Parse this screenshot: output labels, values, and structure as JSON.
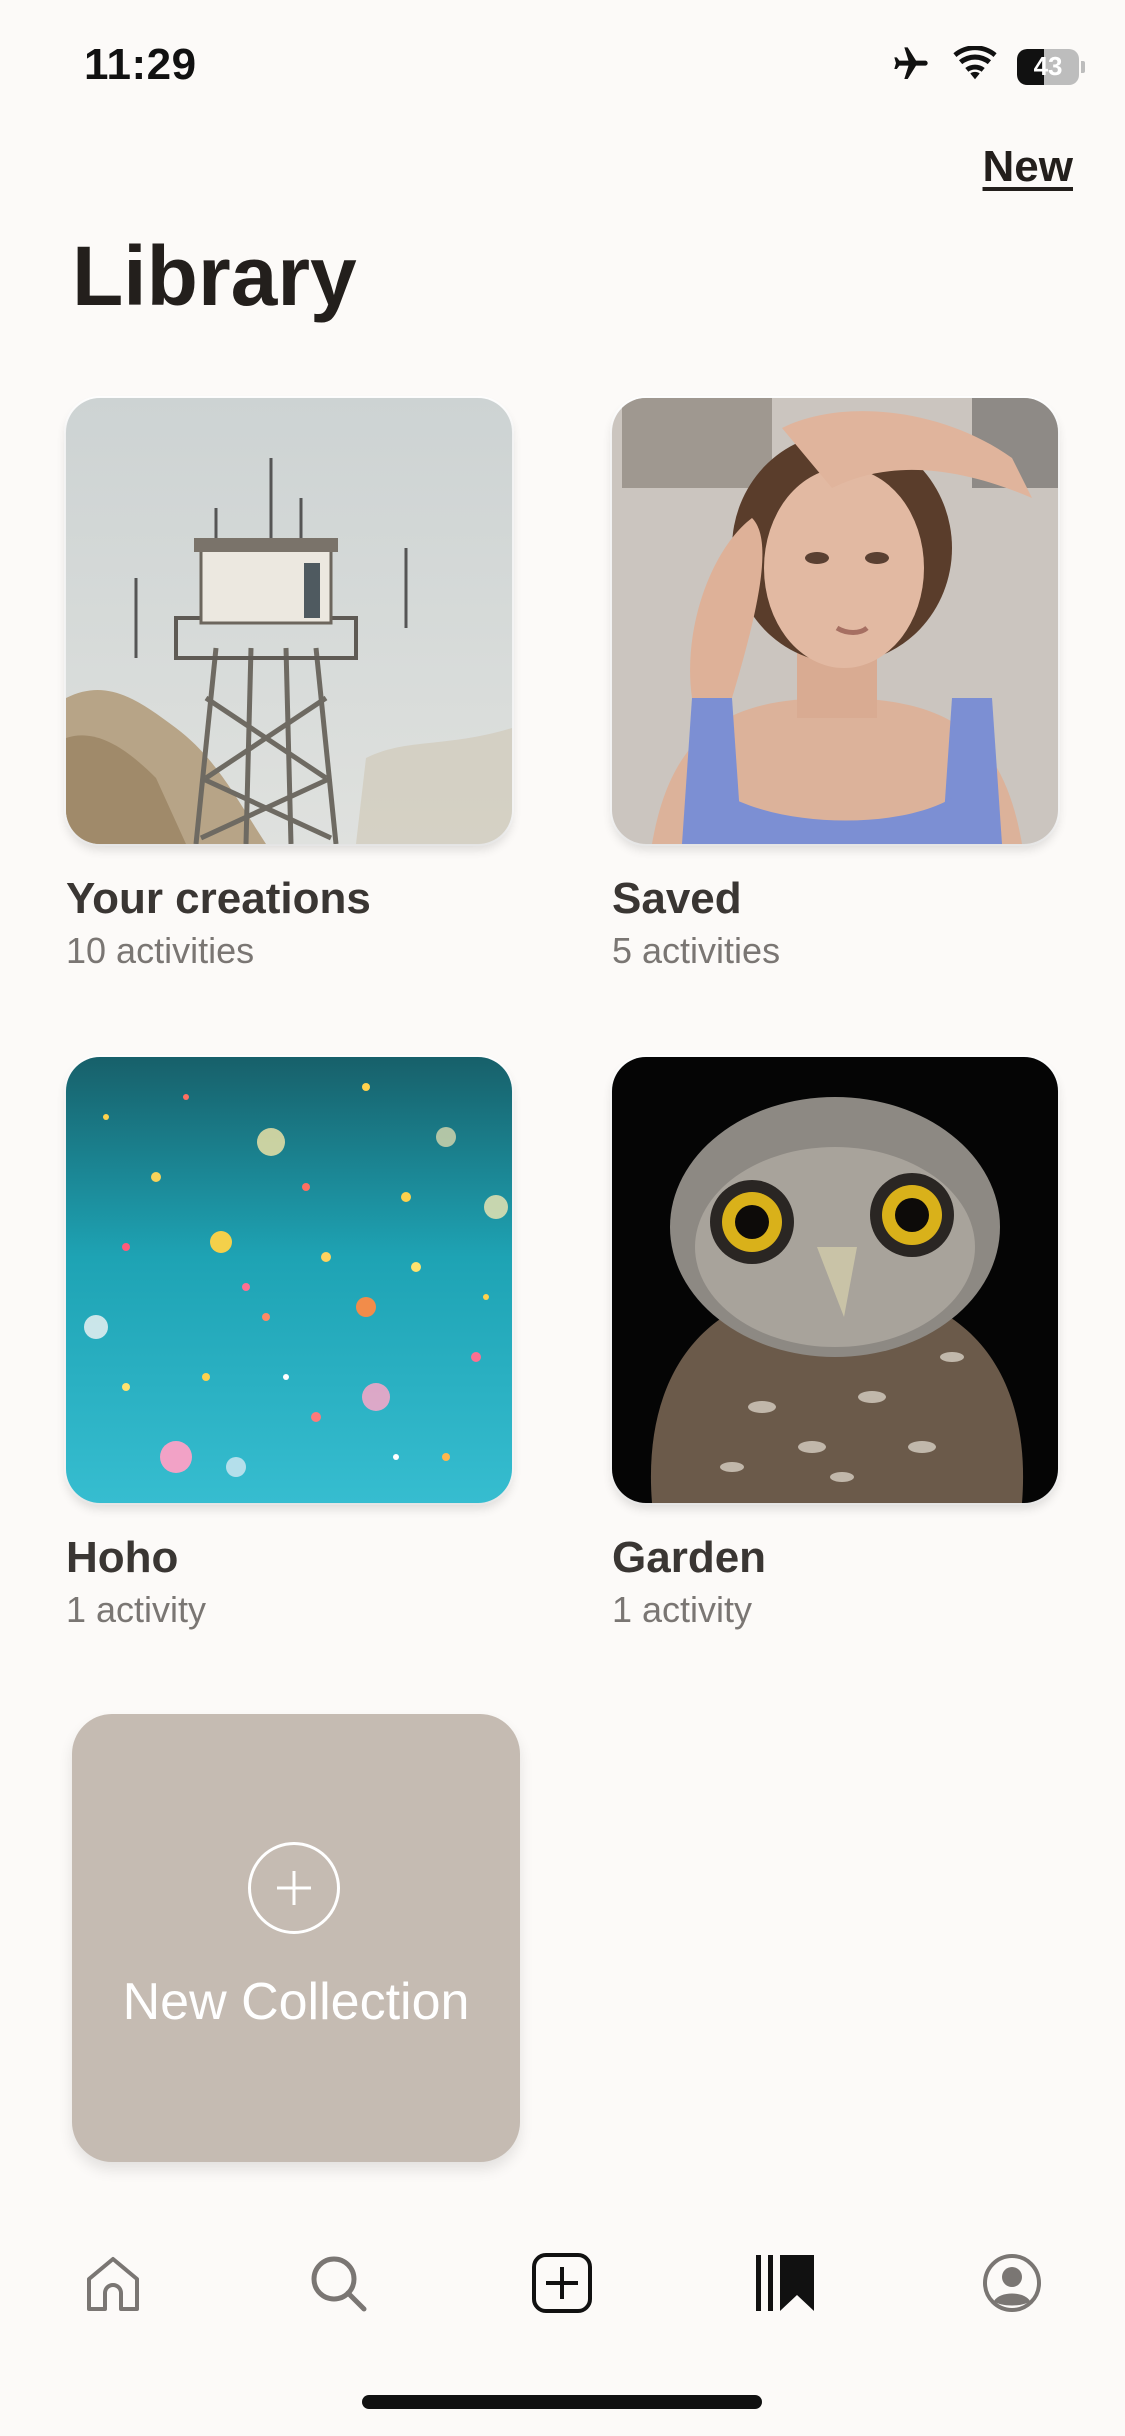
{
  "status_bar": {
    "time": "11:29",
    "battery_level": "43",
    "icons": [
      "airplane-icon",
      "wifi-icon",
      "battery-icon"
    ]
  },
  "header": {
    "new_label": "New",
    "title": "Library"
  },
  "collections": [
    {
      "title": "Your creations",
      "subtitle": "10 activities",
      "image": "watchtower-photo"
    },
    {
      "title": "Saved",
      "subtitle": "5 activities",
      "image": "woman-portrait-photo"
    },
    {
      "title": "Hoho",
      "subtitle": "1 activity",
      "image": "confetti-photo"
    },
    {
      "title": "Garden",
      "subtitle": "1 activity",
      "image": "owl-photo"
    }
  ],
  "new_collection": {
    "label": "New Collection",
    "icon": "plus-circle-icon"
  },
  "bottom_nav": {
    "items": [
      {
        "name": "home",
        "icon": "home-icon",
        "active": false
      },
      {
        "name": "search",
        "icon": "search-icon",
        "active": false
      },
      {
        "name": "create",
        "icon": "plus-square-icon",
        "active": false
      },
      {
        "name": "library",
        "icon": "library-icon",
        "active": true
      },
      {
        "name": "profile",
        "icon": "profile-icon",
        "active": false
      }
    ]
  },
  "colors": {
    "background": "#fcfaf8",
    "text_primary": "#231f1c",
    "text_secondary": "#7a7673",
    "new_collection_bg": "#c5bbb2"
  }
}
